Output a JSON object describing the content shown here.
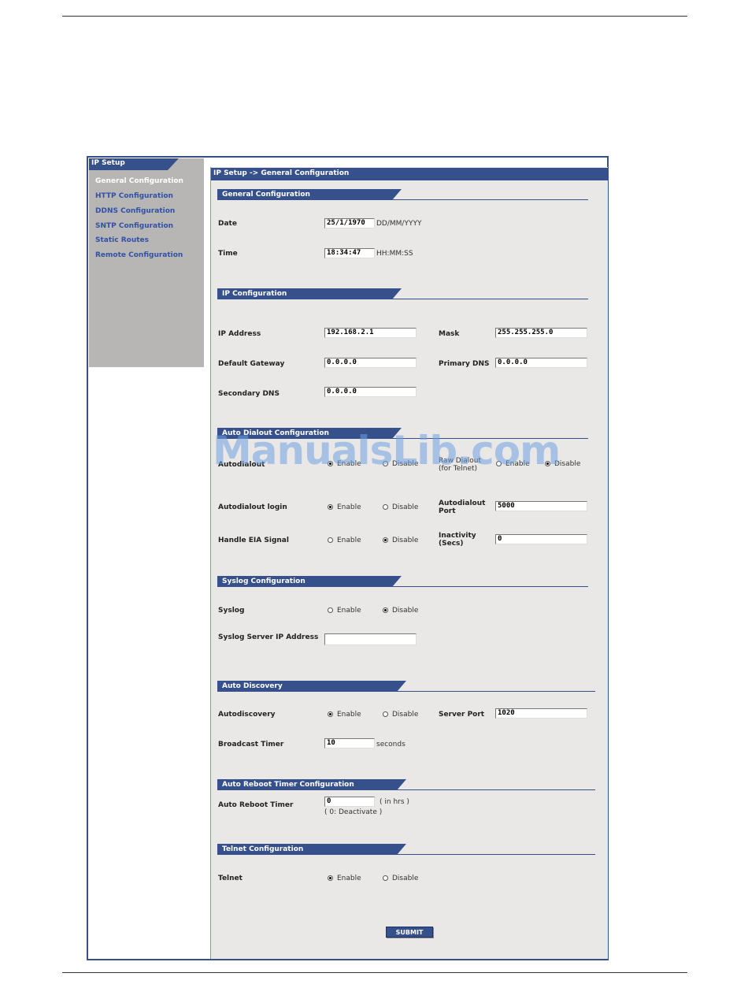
{
  "sidebar": {
    "title": "IP Setup",
    "items": [
      {
        "label": "General Configuration",
        "active": true
      },
      {
        "label": "HTTP Configuration",
        "active": false
      },
      {
        "label": "DDNS Configuration",
        "active": false
      },
      {
        "label": "SNTP Configuration",
        "active": false
      },
      {
        "label": "Static Routes",
        "active": false
      },
      {
        "label": "Remote Configuration",
        "active": false
      }
    ]
  },
  "breadcrumb": "IP Setup  ->  General Configuration",
  "general": {
    "title": "General Configuration",
    "date_label": "Date",
    "date_value": "25/1/1970",
    "date_format": "DD/MM/YYYY",
    "time_label": "Time",
    "time_value": "18:34:47",
    "time_format": "HH:MM:SS"
  },
  "ip": {
    "title": "IP Configuration",
    "ip_label": "IP Address",
    "ip_value": "192.168.2.1",
    "mask_label": "Mask",
    "mask_value": "255.255.255.0",
    "gateway_label": "Default Gateway",
    "gateway_value": "0.0.0.0",
    "primary_dns_label": "Primary DNS",
    "primary_dns_value": "0.0.0.0",
    "secondary_dns_label": "Secondary DNS",
    "secondary_dns_value": "0.0.0.0"
  },
  "autodialout": {
    "title": "Auto Dialout Configuration",
    "autodialout_label": "Autodialout",
    "raw_dialout_label": "Raw Dialout",
    "raw_dialout_sub": "(for Telnet)",
    "login_label": "Autodialout login",
    "port_label_1": "Autodialout",
    "port_label_2": "Port",
    "port_value": "5000",
    "eia_label": "Handle EIA Signal",
    "inactivity_label_1": "Inactivity",
    "inactivity_label_2": "(Secs)",
    "inactivity_value": "0"
  },
  "syslog": {
    "title": "Syslog Configuration",
    "syslog_label": "Syslog",
    "server_label": "Syslog Server IP Address",
    "server_value": ""
  },
  "discovery": {
    "title": "Auto Discovery",
    "autodiscovery_label": "Autodiscovery",
    "server_port_label": "Server Port",
    "server_port_value": "1020",
    "broadcast_label": "Broadcast Timer",
    "broadcast_value": "10",
    "broadcast_unit": "seconds"
  },
  "reboot": {
    "title": "Auto Reboot Timer Configuration",
    "timer_label": "Auto Reboot Timer",
    "timer_value": "0",
    "unit": "( in hrs )",
    "note": "( 0: Deactivate )"
  },
  "telnet": {
    "title": "Telnet Configuration",
    "telnet_label": "Telnet"
  },
  "options": {
    "enable": "Enable",
    "disable": "Disable"
  },
  "radio_state": {
    "autodialout": "enable",
    "raw_dialout": "disable",
    "autodialout_login": "enable",
    "eia": "disable",
    "syslog": "disable",
    "autodiscovery": "enable",
    "telnet": "enable"
  },
  "submit_label": "SUBMIT",
  "watermark": "ManualsLib.com",
  "colors": {
    "accent": "#36508c",
    "panel": "#eae8e6",
    "sidebar": "#b8b6b4",
    "link": "#2f52a6"
  }
}
